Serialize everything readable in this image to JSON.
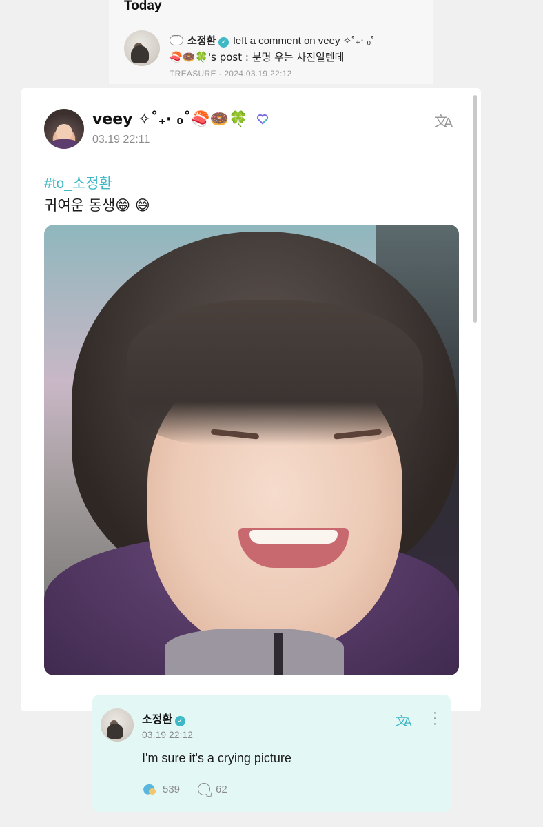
{
  "notification": {
    "heading": "Today",
    "commenter": "소정환",
    "action_text": "left a comment on veey ✧˚₊‧ ₀˚",
    "post_line": "🍣🍩🍀's post : 분명 우는 사진일텐데",
    "source": "TREASURE",
    "separator": "·",
    "datetime": "2024.03.19 22:12",
    "icon": "speech-bubble-icon"
  },
  "post": {
    "author": "veey ✧˚₊‧ ₀˚🍣🍩🍀",
    "time": "03.19 22:11",
    "hashtag": "#to_소정환",
    "text": "귀여운 동생😁 😅",
    "badge_icon": "heart-badge-icon",
    "translate_icon": "translate-icon"
  },
  "comment": {
    "author": "소정환",
    "time": "03.19 22:12",
    "body": "I'm sure it's a crying picture",
    "likes": "539",
    "replies": "62"
  },
  "colors": {
    "accent": "#3fb8c6",
    "comment_bg": "#e3f7f5",
    "page_bg": "#f0f0f0"
  }
}
